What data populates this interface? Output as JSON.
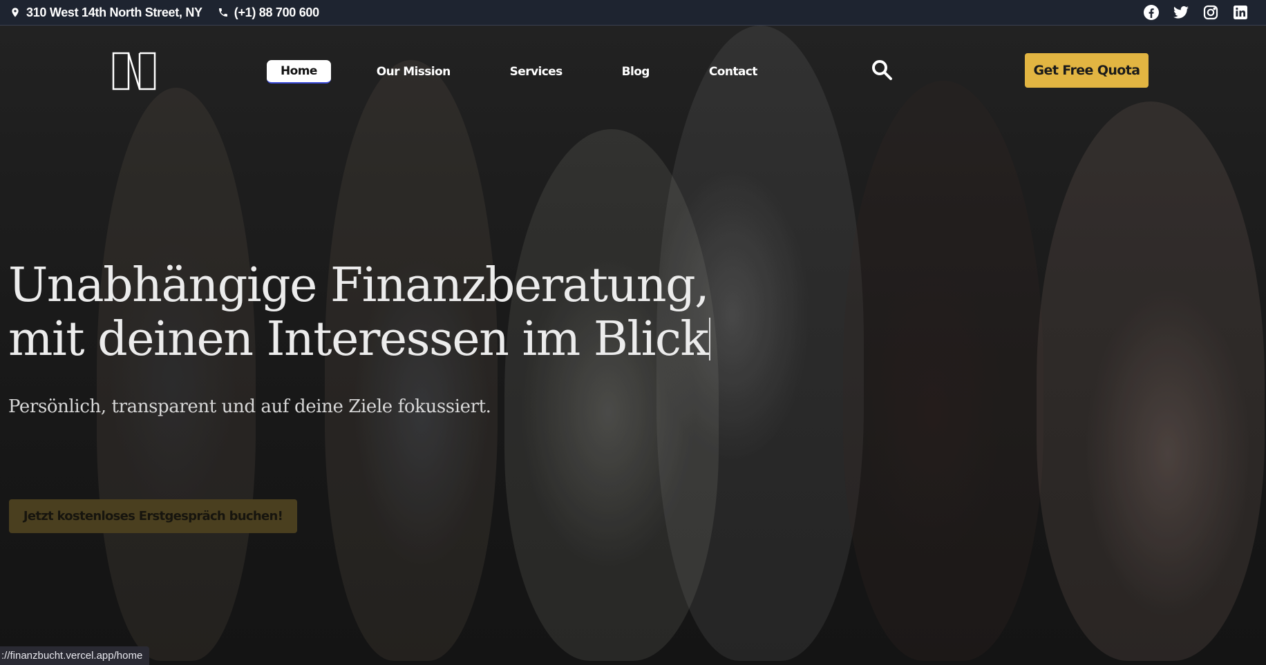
{
  "topbar": {
    "address": "310 West 14th North Street, NY",
    "phone": "(+1) 88 700 600",
    "socials": [
      "facebook-icon",
      "twitter-icon",
      "instagram-icon",
      "linkedin-icon"
    ]
  },
  "nav": {
    "items": [
      {
        "label": "Home",
        "active": true
      },
      {
        "label": "Our Mission"
      },
      {
        "label": "Services"
      },
      {
        "label": "Blog"
      },
      {
        "label": "Contact"
      }
    ],
    "cta_label": "Get Free Quota"
  },
  "hero": {
    "headline_line1": "Unabhängige Finanzberatung,",
    "headline_line2": "mit deinen Interessen im Blick",
    "subline": "Persönlich, transparent und auf deine Ziele fokussiert.",
    "cta_label": "Jetzt kostenloses Erstgespräch buchen!"
  },
  "status": {
    "url": "://finanzbucht.vercel.app/home"
  },
  "colors": {
    "accent": "#e2b542",
    "topbar": "#1e2430",
    "active_underline": "#3a49d8"
  }
}
